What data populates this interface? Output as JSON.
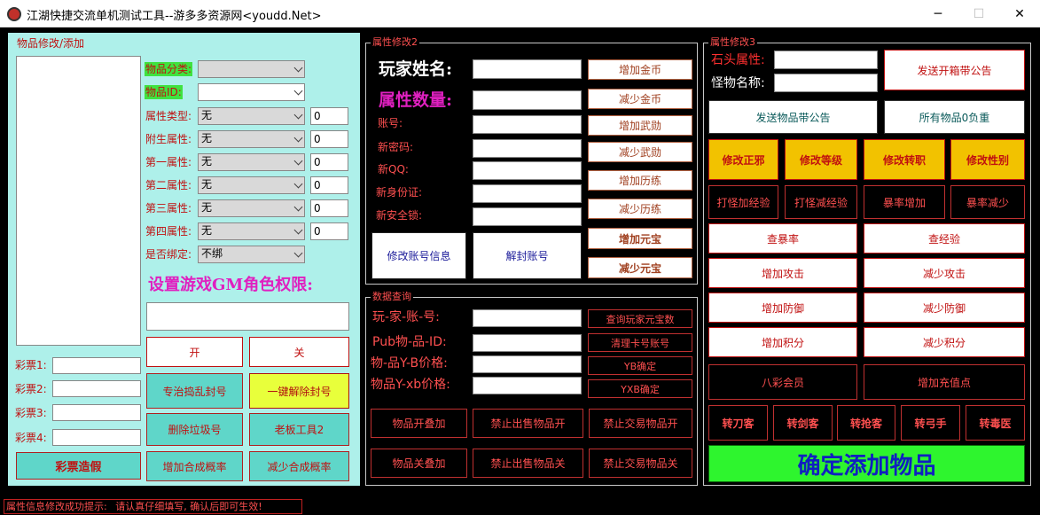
{
  "window": {
    "title": "江湖快捷交流单机测试工具--游多多资源网<youdd.Net>",
    "minimize": "─",
    "maximize": "☐",
    "close": "✕"
  },
  "colors": {
    "accent_red": "#ff5050",
    "teal_panel": "#aef0ea",
    "green_button": "#2ef52e",
    "gold_button": "#f2c200"
  },
  "left": {
    "group_label": "物品修改/添加",
    "category_label": "物品分类:",
    "item_id_label": "物品ID:",
    "attr_rows": [
      {
        "label": "属性类型:",
        "value": "无",
        "num": "0"
      },
      {
        "label": "附生属性:",
        "value": "无",
        "num": "0"
      },
      {
        "label": "第一属性:",
        "value": "无",
        "num": "0"
      },
      {
        "label": "第二属性:",
        "value": "无",
        "num": "0"
      },
      {
        "label": "第三属性:",
        "value": "无",
        "num": "0"
      },
      {
        "label": "第四属性:",
        "value": "无",
        "num": "0"
      }
    ],
    "bind_label": "是否绑定:",
    "bind_value": "不绑",
    "gm_heading": "设置游戏GM角色权限:",
    "lottery": [
      "彩票1:",
      "彩票2:",
      "彩票3:",
      "彩票4:"
    ],
    "lottery_fake_button": "彩票造假",
    "on_button": "开",
    "off_button": "关",
    "fix_ban_button": "专治捣乱封号",
    "unban_all_button": "一键解除封号",
    "delete_junk_button": "删除垃圾号",
    "boss_tool_button": "老板工具2",
    "add_rate_button": "增加合成概率",
    "reduce_rate_button": "减少合成概率"
  },
  "mid": {
    "group_label": "属性修改2",
    "player_name_label": "玩家姓名:",
    "attr_count_label": "属性数量:",
    "account_fields": [
      "账号:",
      "新密码:",
      "新QQ:",
      "新身份证:",
      "新安全锁:"
    ],
    "right_buttons": [
      "增加金币",
      "减少金币",
      "增加武勋",
      "减少武勋",
      "增加历练",
      "减少历练",
      "增加元宝",
      "减少元宝"
    ],
    "modify_account_button": "修改账号信息",
    "unban_account_button": "解封账号",
    "query_group_label": "数据查询",
    "query_labels": [
      "玩-家-账-号:",
      "Pub物-品-ID:",
      "物-品Y-B价格:",
      "物品Y-xb价格:"
    ],
    "query_buttons": [
      "查询玩家元宝数",
      "清理卡号账号",
      "YB确定",
      "YXB确定"
    ],
    "item_stack_on": "物品开叠加",
    "ban_sell_on": "禁止出售物品开",
    "ban_trade_on": "禁止交易物品开",
    "item_stack_off": "物品关叠加",
    "ban_sell_off": "禁止出售物品关",
    "ban_trade_off": "禁止交易物品关"
  },
  "right": {
    "group_label": "属性修改3",
    "stone_label": "石头属性:",
    "monster_label": "怪物名称:",
    "announce_box_button": "发送开箱带公告",
    "announce_item_button": "发送物品带公告",
    "all_items_zero_button": "所有物品0负重",
    "gold_buttons": [
      "修改正邪",
      "修改等级",
      "修改转职",
      "修改性别"
    ],
    "exp_buttons": [
      "打怪加经验",
      "打怪减经验",
      "暴率增加",
      "暴率减少"
    ],
    "pair_buttons": [
      [
        "查暴率",
        "查经验"
      ],
      [
        "增加攻击",
        "减少攻击"
      ],
      [
        "增加防御",
        "减少防御"
      ],
      [
        "增加积分",
        "减少积分"
      ]
    ],
    "vip_button": "八彩会员",
    "add_recharge_button": "增加充值点",
    "class_buttons": [
      "转刀客",
      "转剑客",
      "转抢客",
      "转弓手",
      "转毒医"
    ],
    "confirm_add_button": "确定添加物品"
  },
  "status": {
    "prefix": "属性信息修改成功提示:",
    "message": "请认真仔细填写, 确认后即可生效!"
  }
}
